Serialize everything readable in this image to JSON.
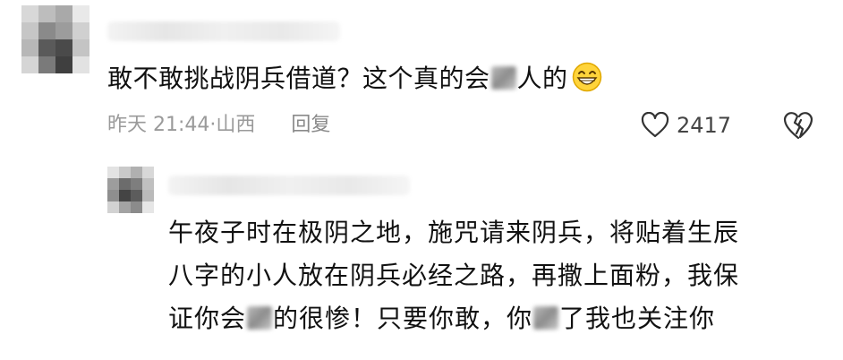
{
  "comment": {
    "text_before": "敢不敢挑战阴兵借道？这个真的会",
    "text_after": "人的",
    "emoji": "grinning-face-icon",
    "time": "昨天 21:44·山西",
    "reply_label": "回复",
    "like_count": "2417",
    "like_icon": "heart-outline-icon",
    "dislike_icon": "broken-heart-icon"
  },
  "reply": {
    "line1": "午夜子时在极阴之地，施咒请来阴兵，将贴着生辰",
    "line2": "八字的小人放在阴兵必经之路，再撒上面粉，我保",
    "line3_a": "证你会",
    "line3_b": "的很惨！只要你敢，你",
    "line3_c": "了我也关注你"
  }
}
